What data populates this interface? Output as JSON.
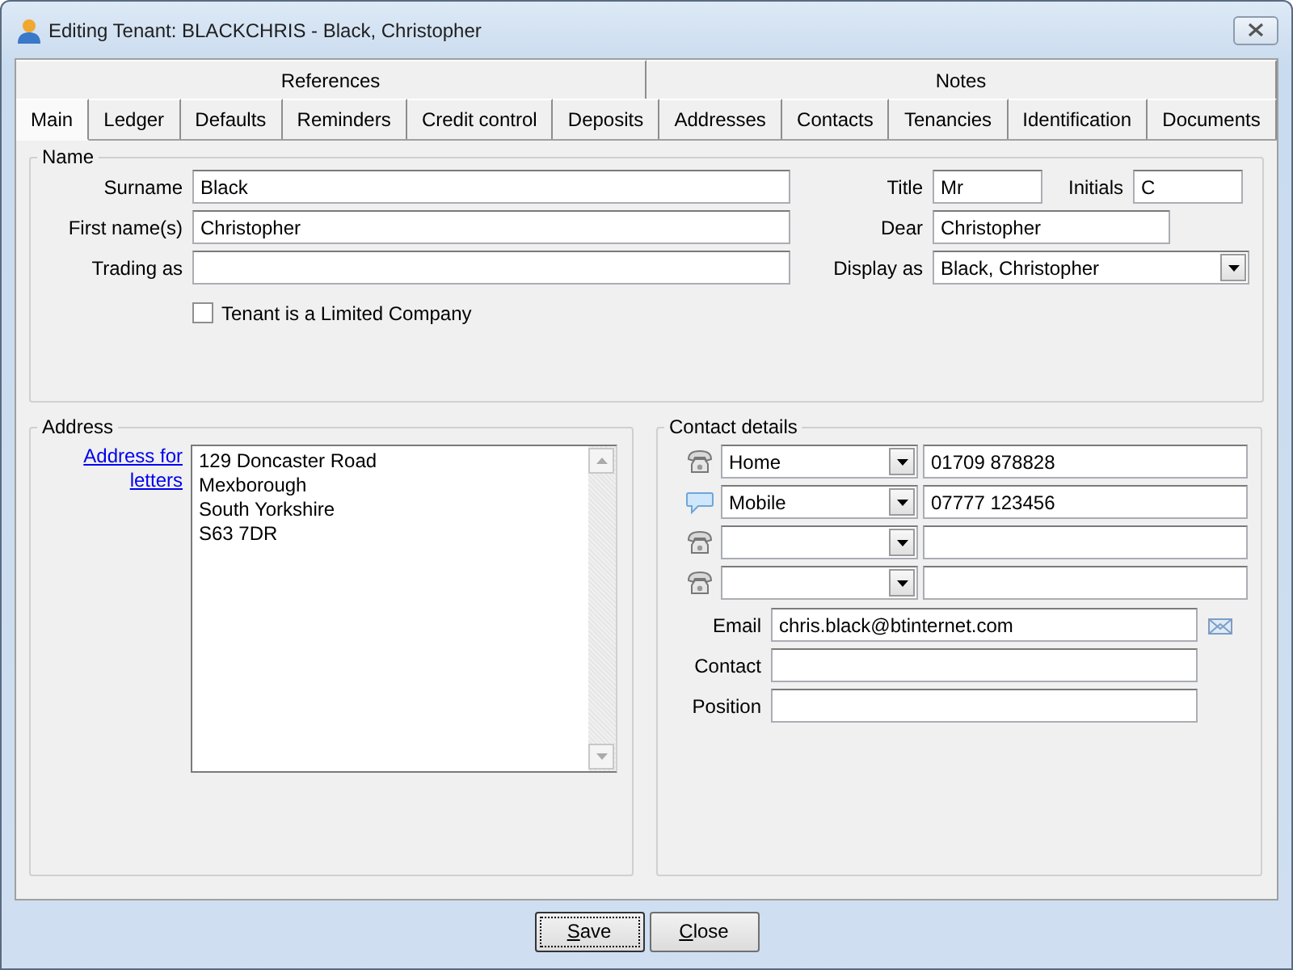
{
  "window": {
    "title": "Editing Tenant: BLACKCHRIS - Black, Christopher"
  },
  "tab_rows": [
    [
      {
        "label": "References",
        "selected": false
      },
      {
        "label": "Notes",
        "selected": false
      }
    ],
    [
      {
        "label": "Main",
        "selected": true
      },
      {
        "label": "Ledger",
        "selected": false
      },
      {
        "label": "Defaults",
        "selected": false
      },
      {
        "label": "Reminders",
        "selected": false
      },
      {
        "label": "Credit control",
        "selected": false
      },
      {
        "label": "Deposits",
        "selected": false
      },
      {
        "label": "Addresses",
        "selected": false
      },
      {
        "label": "Contacts",
        "selected": false
      },
      {
        "label": "Tenancies",
        "selected": false
      },
      {
        "label": "Identification",
        "selected": false
      },
      {
        "label": "Documents",
        "selected": false
      }
    ]
  ],
  "name_section": {
    "legend": "Name",
    "surname": {
      "label": "Surname",
      "value": "Black"
    },
    "first_names": {
      "label": "First name(s)",
      "value": "Christopher"
    },
    "trading_as": {
      "label": "Trading as"
    },
    "title": {
      "label": "Title",
      "value": "Mr"
    },
    "initials": {
      "label": "Initials",
      "value": "C"
    },
    "dear": {
      "label": "Dear",
      "value": "Christopher"
    },
    "display_as": {
      "label": "Display as",
      "value": "Black, Christopher"
    },
    "limited_company": {
      "label": "Tenant is a Limited Company",
      "checked": false
    }
  },
  "address_section": {
    "legend": "Address",
    "link": "Address for letters",
    "lines": [
      "129 Doncaster Road",
      "Mexborough",
      "South Yorkshire",
      "S63 7DR"
    ]
  },
  "contact_section": {
    "legend": "Contact details",
    "phones": [
      {
        "kind": "phone",
        "type": "Home",
        "number": "01709 878828"
      },
      {
        "kind": "chat",
        "type": "Mobile",
        "number": "07777 123456"
      },
      {
        "kind": "phone"
      },
      {
        "kind": "phone"
      }
    ],
    "email": {
      "label": "Email",
      "value": "chris.black@btinternet.com"
    },
    "contact": {
      "label": "Contact"
    },
    "position": {
      "label": "Position"
    }
  },
  "buttons": [
    {
      "label": "Save",
      "mnemonic": true,
      "default": true
    },
    {
      "label": "Close",
      "mnemonic": true,
      "default": false
    }
  ]
}
